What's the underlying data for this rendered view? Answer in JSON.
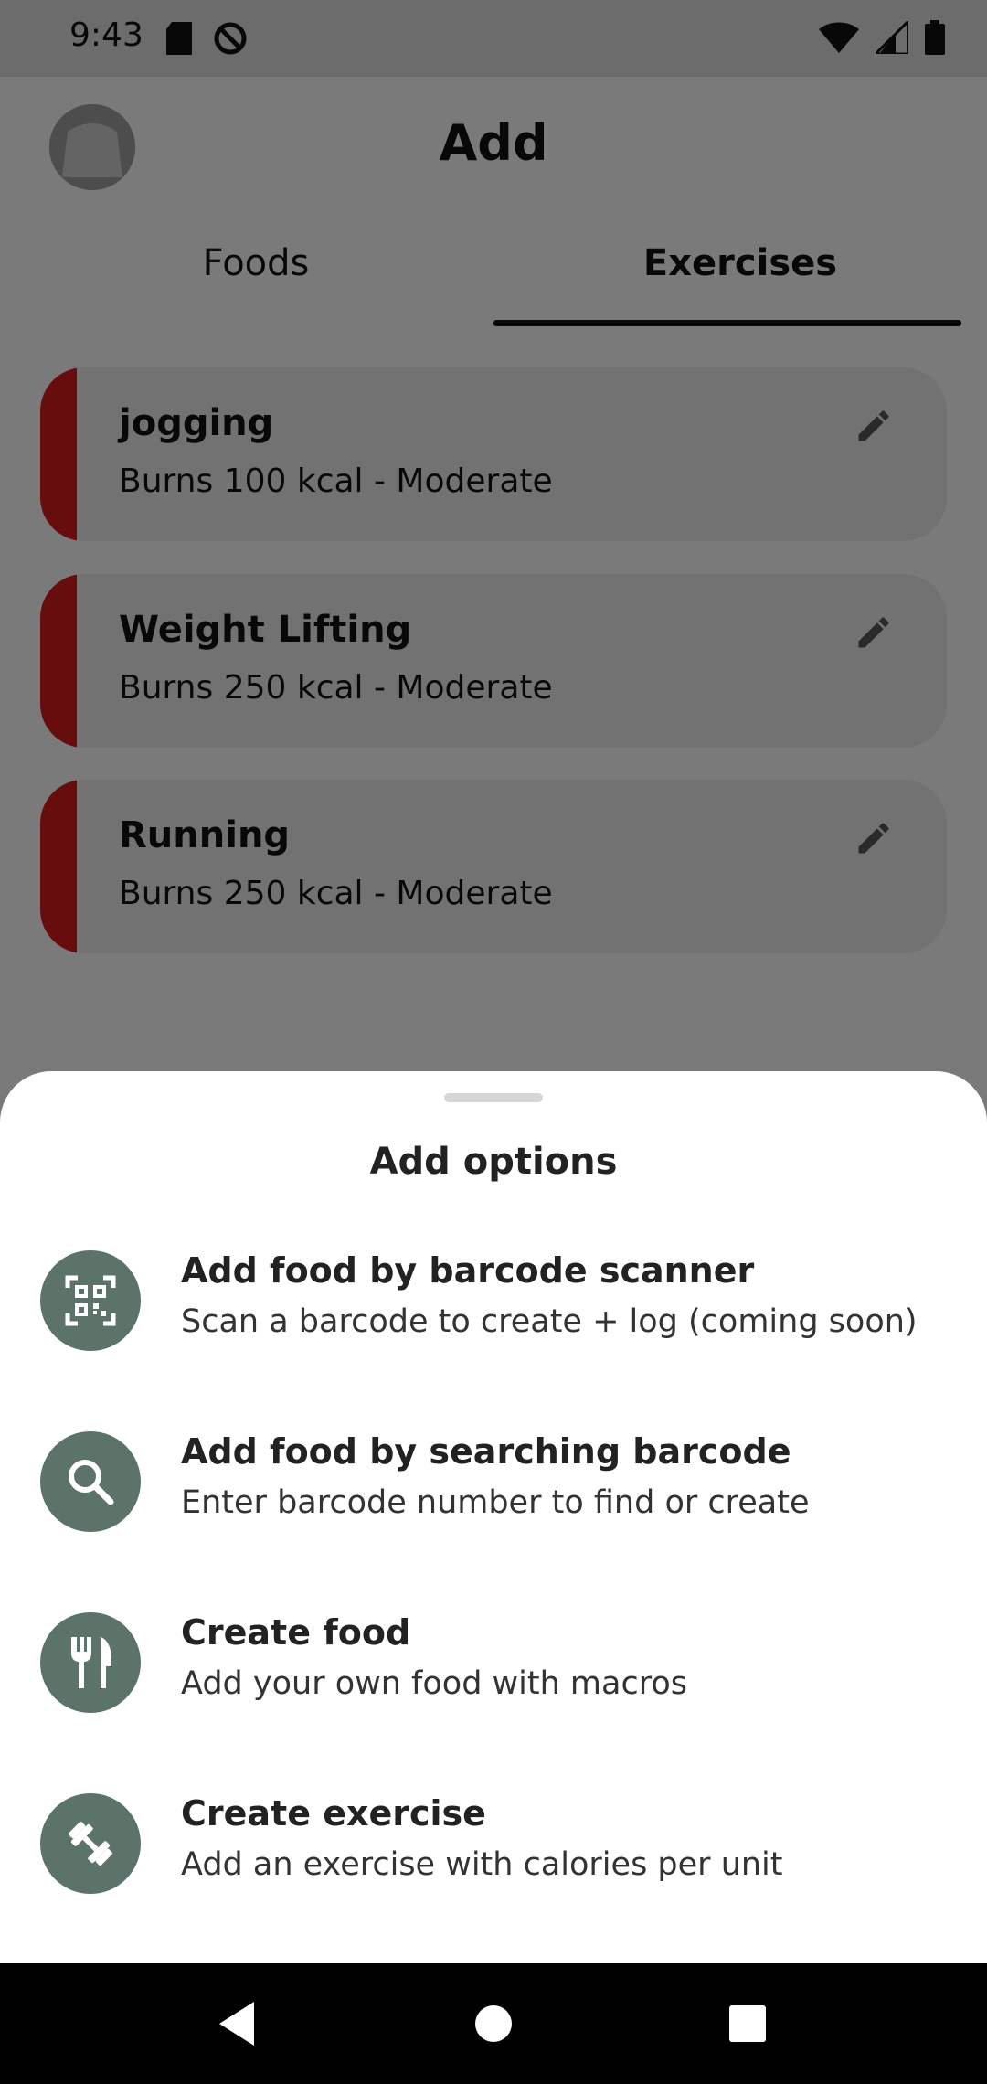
{
  "status_bar": {
    "time": "9:43"
  },
  "header": {
    "title": "Add"
  },
  "tabs": [
    {
      "label": "Foods",
      "selected": false
    },
    {
      "label": "Exercises",
      "selected": true
    }
  ],
  "exercises": [
    {
      "name": "jogging",
      "meta": "Burns 100 kcal  -  Moderate"
    },
    {
      "name": "Weight Lifting",
      "meta": "Burns 250 kcal  -  Moderate"
    },
    {
      "name": "Running",
      "meta": "Burns 250 kcal  -  Moderate"
    }
  ],
  "sheet": {
    "title": "Add options",
    "options": [
      {
        "title": "Add food by barcode scanner",
        "subtitle": "Scan a barcode to create + log (coming soon)",
        "icon": "qr-scanner-icon"
      },
      {
        "title": "Add food by searching barcode",
        "subtitle": "Enter barcode number to find or create",
        "icon": "search-icon"
      },
      {
        "title": "Create food",
        "subtitle": "Add your own food with macros",
        "icon": "fork-knife-icon"
      },
      {
        "title": "Create exercise",
        "subtitle": "Add an exercise with calories per unit",
        "icon": "dumbbell-icon"
      }
    ]
  },
  "colors": {
    "accent_stripe": "#d01b1b",
    "option_icon_bg": "#5b7369"
  }
}
